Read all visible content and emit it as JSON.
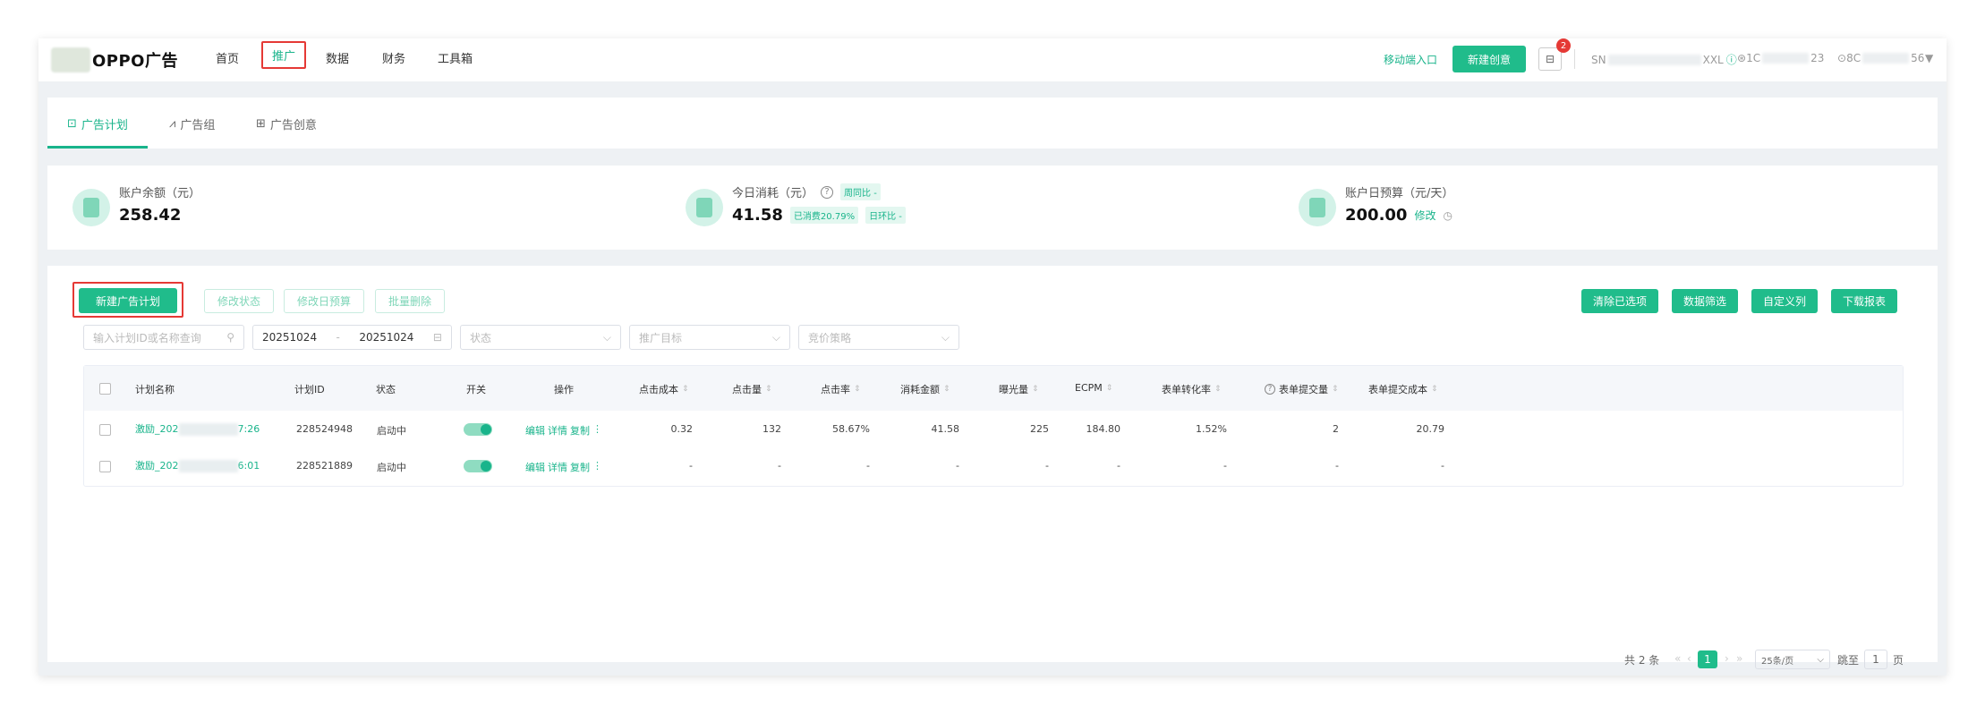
{
  "brand": {
    "logo_text": "OPPO广告"
  },
  "nav": {
    "items": [
      "首页",
      "推广",
      "数据",
      "财务",
      "工具箱"
    ],
    "active": "推广"
  },
  "header": {
    "mobile_link": "移动端入口",
    "new_creative": "新建创意",
    "badge_count": "2",
    "account_prefix": "SN",
    "account_suffix": "XXL",
    "id1_prefix": "1C",
    "id1_suffix": "23",
    "id2_prefix": "8C",
    "id2_suffix": "56"
  },
  "tabs": [
    "广告计划",
    "广告组",
    "广告创意"
  ],
  "stats": {
    "balance_label": "账户余额（元）",
    "balance_value": "258.42",
    "today_label": "今日消耗（元）",
    "today_value": "41.58",
    "today_tag": "已消费20.79%",
    "week_tag": "周同比 -",
    "day_tag": "日环比 -",
    "budget_label": "账户日预算（元/天）",
    "budget_value": "200.00",
    "budget_edit": "修改"
  },
  "toolbar": {
    "new_plan": "新建广告计划",
    "edit_status": "修改状态",
    "edit_budget": "修改日预算",
    "batch_delete": "批量删除",
    "clear": "清除已选项",
    "filter": "数据筛选",
    "custom_cols": "自定义列",
    "download": "下载报表"
  },
  "filters": {
    "search_placeholder": "输入计划ID或名称查询",
    "date_start": "20251024",
    "date_sep": "-",
    "date_end": "20251024",
    "status": "状态",
    "target": "推广目标",
    "bid": "竞价策略"
  },
  "table": {
    "headers": [
      "计划名称",
      "计划ID",
      "状态",
      "开关",
      "操作",
      "点击成本",
      "点击量",
      "点击率",
      "消耗金额",
      "曝光量",
      "ECPM",
      "表单转化率",
      "表单提交量",
      "表单提交成本"
    ],
    "ops": [
      "编辑",
      "详情",
      "复制"
    ],
    "rows": [
      {
        "name_prefix": "激励_202",
        "name_suffix": "7:26",
        "id": "228524948",
        "status": "启动中",
        "cpc": "0.32",
        "clicks": "132",
        "ctr": "58.67%",
        "cost": "41.58",
        "impr": "225",
        "ecpm": "184.80",
        "form_rate": "1.52%",
        "form_cnt": "2",
        "form_cost": "20.79"
      },
      {
        "name_prefix": "激励_202",
        "name_suffix": "6:01",
        "id": "228521889",
        "status": "启动中",
        "cpc": "-",
        "clicks": "-",
        "ctr": "-",
        "cost": "-",
        "impr": "-",
        "ecpm": "-",
        "form_rate": "-",
        "form_cnt": "-",
        "form_cost": "-"
      }
    ]
  },
  "pagination": {
    "total": "共 2 条",
    "current": "1",
    "page_size": "25条/页",
    "jump_label": "跳至",
    "jump_value": "1",
    "page_unit": "页"
  }
}
